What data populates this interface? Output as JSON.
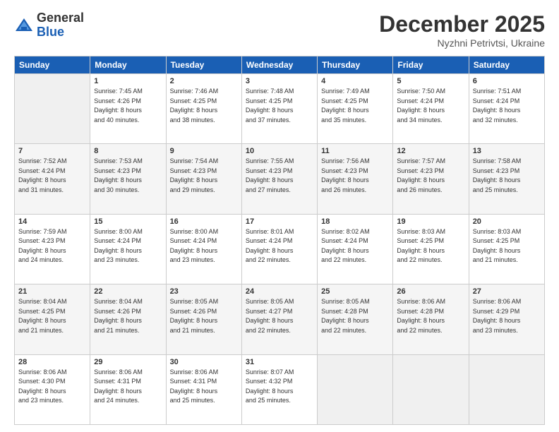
{
  "logo": {
    "general": "General",
    "blue": "Blue"
  },
  "header": {
    "month": "December 2025",
    "location": "Nyzhni Petrivtsi, Ukraine"
  },
  "days_of_week": [
    "Sunday",
    "Monday",
    "Tuesday",
    "Wednesday",
    "Thursday",
    "Friday",
    "Saturday"
  ],
  "weeks": [
    [
      {
        "day": "",
        "info": ""
      },
      {
        "day": "1",
        "info": "Sunrise: 7:45 AM\nSunset: 4:26 PM\nDaylight: 8 hours\nand 40 minutes."
      },
      {
        "day": "2",
        "info": "Sunrise: 7:46 AM\nSunset: 4:25 PM\nDaylight: 8 hours\nand 38 minutes."
      },
      {
        "day": "3",
        "info": "Sunrise: 7:48 AM\nSunset: 4:25 PM\nDaylight: 8 hours\nand 37 minutes."
      },
      {
        "day": "4",
        "info": "Sunrise: 7:49 AM\nSunset: 4:25 PM\nDaylight: 8 hours\nand 35 minutes."
      },
      {
        "day": "5",
        "info": "Sunrise: 7:50 AM\nSunset: 4:24 PM\nDaylight: 8 hours\nand 34 minutes."
      },
      {
        "day": "6",
        "info": "Sunrise: 7:51 AM\nSunset: 4:24 PM\nDaylight: 8 hours\nand 32 minutes."
      }
    ],
    [
      {
        "day": "7",
        "info": "Sunrise: 7:52 AM\nSunset: 4:24 PM\nDaylight: 8 hours\nand 31 minutes."
      },
      {
        "day": "8",
        "info": "Sunrise: 7:53 AM\nSunset: 4:23 PM\nDaylight: 8 hours\nand 30 minutes."
      },
      {
        "day": "9",
        "info": "Sunrise: 7:54 AM\nSunset: 4:23 PM\nDaylight: 8 hours\nand 29 minutes."
      },
      {
        "day": "10",
        "info": "Sunrise: 7:55 AM\nSunset: 4:23 PM\nDaylight: 8 hours\nand 27 minutes."
      },
      {
        "day": "11",
        "info": "Sunrise: 7:56 AM\nSunset: 4:23 PM\nDaylight: 8 hours\nand 26 minutes."
      },
      {
        "day": "12",
        "info": "Sunrise: 7:57 AM\nSunset: 4:23 PM\nDaylight: 8 hours\nand 26 minutes."
      },
      {
        "day": "13",
        "info": "Sunrise: 7:58 AM\nSunset: 4:23 PM\nDaylight: 8 hours\nand 25 minutes."
      }
    ],
    [
      {
        "day": "14",
        "info": "Sunrise: 7:59 AM\nSunset: 4:23 PM\nDaylight: 8 hours\nand 24 minutes."
      },
      {
        "day": "15",
        "info": "Sunrise: 8:00 AM\nSunset: 4:24 PM\nDaylight: 8 hours\nand 23 minutes."
      },
      {
        "day": "16",
        "info": "Sunrise: 8:00 AM\nSunset: 4:24 PM\nDaylight: 8 hours\nand 23 minutes."
      },
      {
        "day": "17",
        "info": "Sunrise: 8:01 AM\nSunset: 4:24 PM\nDaylight: 8 hours\nand 22 minutes."
      },
      {
        "day": "18",
        "info": "Sunrise: 8:02 AM\nSunset: 4:24 PM\nDaylight: 8 hours\nand 22 minutes."
      },
      {
        "day": "19",
        "info": "Sunrise: 8:03 AM\nSunset: 4:25 PM\nDaylight: 8 hours\nand 22 minutes."
      },
      {
        "day": "20",
        "info": "Sunrise: 8:03 AM\nSunset: 4:25 PM\nDaylight: 8 hours\nand 21 minutes."
      }
    ],
    [
      {
        "day": "21",
        "info": "Sunrise: 8:04 AM\nSunset: 4:25 PM\nDaylight: 8 hours\nand 21 minutes."
      },
      {
        "day": "22",
        "info": "Sunrise: 8:04 AM\nSunset: 4:26 PM\nDaylight: 8 hours\nand 21 minutes."
      },
      {
        "day": "23",
        "info": "Sunrise: 8:05 AM\nSunset: 4:26 PM\nDaylight: 8 hours\nand 21 minutes."
      },
      {
        "day": "24",
        "info": "Sunrise: 8:05 AM\nSunset: 4:27 PM\nDaylight: 8 hours\nand 22 minutes."
      },
      {
        "day": "25",
        "info": "Sunrise: 8:05 AM\nSunset: 4:28 PM\nDaylight: 8 hours\nand 22 minutes."
      },
      {
        "day": "26",
        "info": "Sunrise: 8:06 AM\nSunset: 4:28 PM\nDaylight: 8 hours\nand 22 minutes."
      },
      {
        "day": "27",
        "info": "Sunrise: 8:06 AM\nSunset: 4:29 PM\nDaylight: 8 hours\nand 23 minutes."
      }
    ],
    [
      {
        "day": "28",
        "info": "Sunrise: 8:06 AM\nSunset: 4:30 PM\nDaylight: 8 hours\nand 23 minutes."
      },
      {
        "day": "29",
        "info": "Sunrise: 8:06 AM\nSunset: 4:31 PM\nDaylight: 8 hours\nand 24 minutes."
      },
      {
        "day": "30",
        "info": "Sunrise: 8:06 AM\nSunset: 4:31 PM\nDaylight: 8 hours\nand 25 minutes."
      },
      {
        "day": "31",
        "info": "Sunrise: 8:07 AM\nSunset: 4:32 PM\nDaylight: 8 hours\nand 25 minutes."
      },
      {
        "day": "",
        "info": ""
      },
      {
        "day": "",
        "info": ""
      },
      {
        "day": "",
        "info": ""
      }
    ]
  ]
}
